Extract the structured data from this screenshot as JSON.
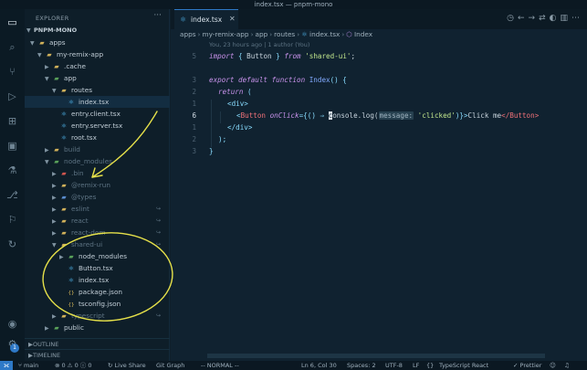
{
  "window": {
    "title": "index.tsx — pnpm-mono"
  },
  "sidebar": {
    "title": "EXPLORER",
    "root": "PNPM-MONO",
    "tree": [
      {
        "label": "apps",
        "depth": 0,
        "kind": "folder",
        "open": true
      },
      {
        "label": "my-remix-app",
        "depth": 1,
        "kind": "folder",
        "open": true
      },
      {
        "label": ".cache",
        "depth": 2,
        "kind": "folder",
        "open": false
      },
      {
        "label": "app",
        "depth": 2,
        "kind": "folder-green",
        "open": true
      },
      {
        "label": "routes",
        "depth": 3,
        "kind": "folder",
        "open": true
      },
      {
        "label": "index.tsx",
        "depth": 4,
        "kind": "tsx",
        "selected": true
      },
      {
        "label": "entry.client.tsx",
        "depth": 3,
        "kind": "tsx"
      },
      {
        "label": "entry.server.tsx",
        "depth": 3,
        "kind": "tsx"
      },
      {
        "label": "root.tsx",
        "depth": 3,
        "kind": "tsx"
      },
      {
        "label": "build",
        "depth": 2,
        "kind": "folder",
        "open": false,
        "dim": true
      },
      {
        "label": "node_modules",
        "depth": 2,
        "kind": "folder-green",
        "open": true,
        "dim": true
      },
      {
        "label": ".bin",
        "depth": 3,
        "kind": "red",
        "open": false,
        "dim": true
      },
      {
        "label": "@remix-run",
        "depth": 3,
        "kind": "folder",
        "open": false,
        "dim": true
      },
      {
        "label": "@types",
        "depth": 3,
        "kind": "folder-blue",
        "open": false,
        "dim": true
      },
      {
        "label": "eslint",
        "depth": 3,
        "kind": "folder",
        "open": false,
        "dim": true,
        "link": true
      },
      {
        "label": "react",
        "depth": 3,
        "kind": "folder",
        "open": false,
        "dim": true,
        "link": true
      },
      {
        "label": "react-dom",
        "depth": 3,
        "kind": "folder",
        "open": false,
        "dim": true,
        "link": true
      },
      {
        "label": "shared-ui",
        "depth": 3,
        "kind": "folder",
        "open": true,
        "dim": true,
        "link": true
      },
      {
        "label": "node_modules",
        "depth": 4,
        "kind": "folder-green",
        "open": false
      },
      {
        "label": "Button.tsx",
        "depth": 4,
        "kind": "tsx"
      },
      {
        "label": "index.tsx",
        "depth": 4,
        "kind": "tsx"
      },
      {
        "label": "package.json",
        "depth": 4,
        "kind": "json"
      },
      {
        "label": "tsconfig.json",
        "depth": 4,
        "kind": "json"
      },
      {
        "label": "typescript",
        "depth": 3,
        "kind": "folder",
        "open": false,
        "dim": true,
        "link": true
      },
      {
        "label": "public",
        "depth": 2,
        "kind": "folder-green",
        "open": false
      }
    ],
    "sections": [
      "OUTLINE",
      "TIMELINE"
    ]
  },
  "editor": {
    "tab": {
      "label": "index.tsx",
      "close": "✕"
    },
    "breadcrumb": [
      "apps",
      "my-remix-app",
      "app",
      "routes",
      "index.tsx",
      "Index"
    ],
    "codelens": "You, 23 hours ago | 1 author (You)",
    "lines": [
      "5",
      "",
      "3",
      "2",
      "1",
      "6",
      "1",
      "2",
      "3"
    ],
    "current_line": "6",
    "code": {
      "l1_import": "import",
      "l1_brace_open": " { ",
      "l1_name": "Button",
      "l1_brace_close": " } ",
      "l1_from": "from",
      "l1_str": "'shared-ui'",
      "l1_end": ";",
      "l3_export": "export default function",
      "l3_fn": "Index",
      "l3_end": "() {",
      "l4_return": "return",
      "l4_paren": " (",
      "l5_div": "<div>",
      "l6_lt": "<",
      "l6_tag": "Button",
      "l6_attr": "onClick",
      "l6_eq": "={",
      "l6_args": "()",
      "l6_arrow": " ⇒ ",
      "l6_cursor": "c",
      "l6_console": "onsole.log(",
      "l6_hint": "message:",
      "l6_str": "'clicked'",
      "l6_close": ")}>",
      "l6_text": "Click me",
      "l6_endtag": "</Button>",
      "l7_div": "</div>",
      "l8": ");",
      "l9": "}"
    }
  },
  "statusbar": {
    "branch": "main",
    "sync": "⊗ 0 ⚠ 0 ⓘ 0",
    "liveshare": "Live Share",
    "gitgraph": "Git Graph",
    "mode": "-- NORMAL --",
    "position": "Ln 6, Col 30",
    "spaces": "Spaces: 2",
    "encoding": "UTF-8",
    "eol": "LF",
    "language": "TypeScript React",
    "prettier": "Prettier"
  },
  "colors": {
    "accent": "#2e79c7",
    "annotation": "#e6e14a",
    "background": "#0f1f2b"
  }
}
